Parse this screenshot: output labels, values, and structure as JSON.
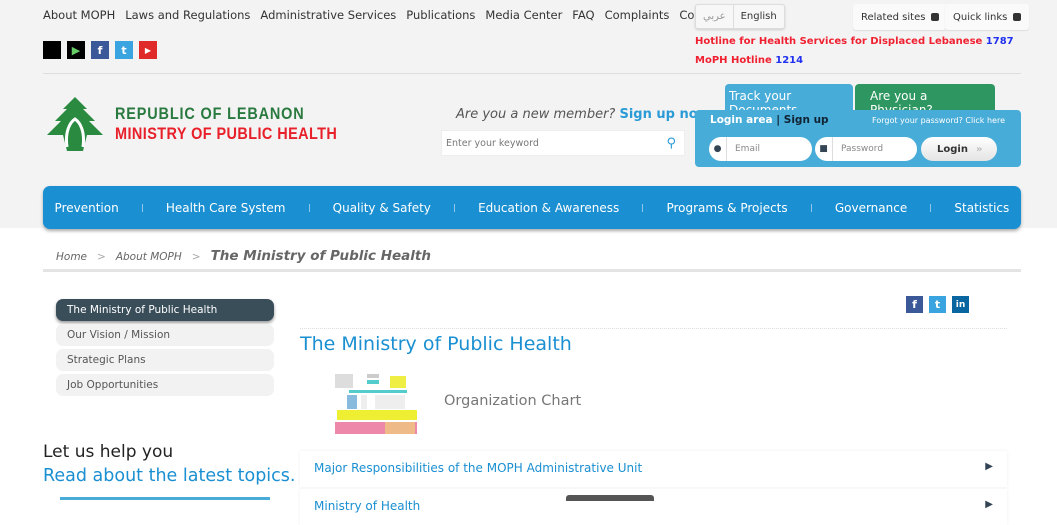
{
  "top_links": [
    "About MOPH",
    "Laws and Regulations",
    "Administrative Services",
    "Publications",
    "Media Center",
    "FAQ",
    "Complaints",
    "Contact us"
  ],
  "social": [
    {
      "icon": "apple-icon",
      "color": "#000"
    },
    {
      "icon": "google-play-icon",
      "color": "#000"
    },
    {
      "icon": "facebook-icon",
      "color": "#3b5998",
      "g": "f"
    },
    {
      "icon": "twitter-icon",
      "color": "#3aa4e0",
      "g": "t"
    },
    {
      "icon": "youtube-icon",
      "color": "#e02a2a",
      "g": "▶"
    }
  ],
  "lang": {
    "arabic": "عربي",
    "english": "English"
  },
  "related_sites": "Related sites",
  "quick_links": "Quick links",
  "hotline1": {
    "text": "Hotline for Health Services for Displaced Lebanese",
    "number": "1787"
  },
  "hotline2": {
    "text": "MoPH Hotline",
    "number": "1214"
  },
  "logo": {
    "line1": "REPUBLIC OF LEBANON",
    "line2": "MINISTRY OF PUBLIC HEALTH"
  },
  "member": {
    "question": "Are you a new member?",
    "signup": "Sign up now"
  },
  "search": {
    "placeholder": "Enter your keyword"
  },
  "tabs": {
    "track": "Track your Documents",
    "physician": "Are you a Physician?"
  },
  "login": {
    "area": "Login area",
    "signup": "| Sign up",
    "forgot": "Forgot your password? Click here",
    "email_placeholder": "Email",
    "password_placeholder": "Password",
    "button": "Login"
  },
  "nav": [
    "Prevention",
    "Health Care System",
    "Quality & Safety",
    "Education & Awareness",
    "Programs & Projects",
    "Governance",
    "Statistics"
  ],
  "breadcrumb": {
    "home": "Home",
    "about": "About MOPH",
    "current": "The Ministry of Public Health"
  },
  "sidebar": [
    "The Ministry of Public Health",
    "Our Vision / Mission",
    "Strategic Plans",
    "Job Opportunities"
  ],
  "page_title": "The Ministry of Public Health",
  "org_chart_label": "Organization Chart",
  "help": {
    "title": "Let us help you",
    "subtitle": "Read about the latest topics."
  },
  "accordion": [
    "Major Responsibilities of the MOPH Administrative Unit",
    "Ministry of Health"
  ]
}
